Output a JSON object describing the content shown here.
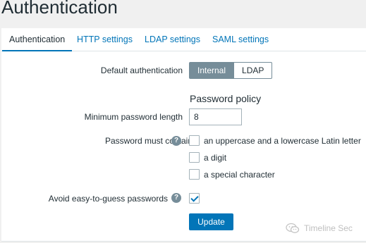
{
  "page": {
    "title": "Authentication"
  },
  "tabs": [
    {
      "label": "Authentication",
      "active": true
    },
    {
      "label": "HTTP settings",
      "active": false
    },
    {
      "label": "LDAP settings",
      "active": false
    },
    {
      "label": "SAML settings",
      "active": false
    }
  ],
  "form": {
    "default_auth": {
      "label": "Default authentication",
      "options": [
        "Internal",
        "LDAP"
      ],
      "selected": "Internal"
    },
    "password_policy": {
      "title": "Password policy",
      "min_length": {
        "label": "Minimum password length",
        "value": "8"
      },
      "must_contain": {
        "label": "Password must contain",
        "help_icon": "question-circle-icon",
        "options": [
          {
            "label": "an uppercase and a lowercase Latin letter",
            "checked": false
          },
          {
            "label": "a digit",
            "checked": false
          },
          {
            "label": "a special character",
            "checked": false
          }
        ]
      },
      "avoid_easy": {
        "label": "Avoid easy-to-guess passwords",
        "help_icon": "question-circle-icon",
        "checked": true
      }
    },
    "update_label": "Update"
  },
  "watermark": {
    "text": "Timeline Sec",
    "icon": "wechat-icon"
  },
  "colors": {
    "accent": "#0275b8",
    "segment_selected_bg": "#768d99",
    "text": "#1f2c33",
    "page_bg": "#f0f0f0"
  }
}
